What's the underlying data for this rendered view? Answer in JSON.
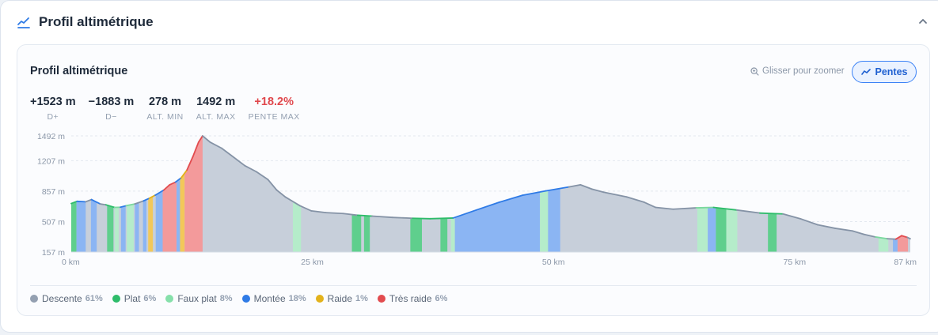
{
  "header": {
    "title": "Profil altimétrique",
    "icon": "chart-line-icon",
    "collapse_icon": "chevron-up-icon"
  },
  "card": {
    "title": "Profil altimétrique",
    "zoom_hint": "Glisser pour zoomer",
    "slopes_button": "Pentes"
  },
  "stats": [
    {
      "value": "+1523 m",
      "label": "D+"
    },
    {
      "value": "−1883 m",
      "label": "D−"
    },
    {
      "value": "278 m",
      "label": "ALT. MIN"
    },
    {
      "value": "1492 m",
      "label": "ALT. MAX"
    },
    {
      "value": "+18.2%",
      "label": "PENTE MAX"
    }
  ],
  "colors": {
    "descente": "#94a0b1",
    "plat": "#2ebc6a",
    "faux_plat": "#86e0aa",
    "montee": "#2f7be6",
    "raide": "#e3b21b",
    "tres_raide": "#e24b4e"
  },
  "legend": [
    {
      "label": "Descente",
      "pct": "61%",
      "color": "#94a0b1"
    },
    {
      "label": "Plat",
      "pct": "6%",
      "color": "#2ebc6a"
    },
    {
      "label": "Faux plat",
      "pct": "8%",
      "color": "#86e0aa"
    },
    {
      "label": "Montée",
      "pct": "18%",
      "color": "#2f7be6"
    },
    {
      "label": "Raide",
      "pct": "1%",
      "color": "#e3b21b"
    },
    {
      "label": "Très raide",
      "pct": "6%",
      "color": "#e24b4e"
    }
  ],
  "chart_data": {
    "type": "area",
    "xlabel": "",
    "ylabel": "",
    "x_unit": "km",
    "y_unit": "m",
    "xlim": [
      0,
      87
    ],
    "ylim": [
      157,
      1492
    ],
    "x_ticks": [
      "0 km",
      "25 km",
      "50 km",
      "75 km",
      "87 km"
    ],
    "x_tick_values": [
      0,
      25,
      50,
      75,
      87
    ],
    "y_ticks": [
      "1492 m",
      "1207 m",
      "857 m",
      "507 m",
      "157 m"
    ],
    "y_tick_values": [
      1492,
      1207,
      857,
      507,
      157
    ],
    "grid": true,
    "series": [
      {
        "name": "",
        "points": [
          [
            0,
            715
          ],
          [
            1,
            740
          ],
          [
            2.5,
            735
          ],
          [
            3.5,
            760
          ],
          [
            5,
            710
          ],
          [
            6,
            700
          ],
          [
            6.5,
            690
          ],
          [
            7.5,
            670
          ],
          [
            8.5,
            672
          ],
          [
            9.5,
            690
          ],
          [
            11,
            710
          ],
          [
            12.5,
            745
          ],
          [
            13.5,
            775
          ],
          [
            14.5,
            810
          ],
          [
            16,
            870
          ],
          [
            17,
            930
          ],
          [
            18,
            960
          ],
          [
            19,
            1010
          ],
          [
            20,
            1100
          ],
          [
            21,
            1250
          ],
          [
            22,
            1420
          ],
          [
            22.7,
            1492
          ],
          [
            24,
            1420
          ],
          [
            26,
            1350
          ],
          [
            28,
            1250
          ],
          [
            30,
            1150
          ],
          [
            32,
            1080
          ],
          [
            34,
            990
          ],
          [
            35.5,
            870
          ],
          [
            37,
            790
          ],
          [
            39.5,
            690
          ],
          [
            41.5,
            630
          ],
          [
            44,
            610
          ],
          [
            47,
            600
          ],
          [
            49.5,
            580
          ],
          [
            52,
            570
          ],
          [
            55.5,
            555
          ],
          [
            59,
            545
          ],
          [
            62,
            540
          ],
          [
            66,
            548
          ],
          [
            70,
            640
          ],
          [
            74,
            730
          ],
          [
            78,
            810
          ],
          [
            82,
            860
          ],
          [
            86,
            905
          ],
          [
            88,
            930
          ],
          [
            90,
            880
          ],
          [
            92,
            845
          ],
          [
            96,
            790
          ],
          [
            99,
            730
          ],
          [
            101,
            670
          ],
          [
            104,
            650
          ],
          [
            108,
            665
          ],
          [
            111,
            670
          ],
          [
            115,
            640
          ],
          [
            119,
            605
          ],
          [
            123,
            595
          ],
          [
            126,
            540
          ],
          [
            129,
            470
          ],
          [
            132,
            430
          ],
          [
            135,
            400
          ],
          [
            137,
            360
          ],
          [
            139,
            330
          ],
          [
            141,
            310
          ],
          [
            142.5,
            305
          ],
          [
            143.5,
            345
          ],
          [
            144.5,
            325
          ],
          [
            145,
            310
          ]
        ]
      }
    ],
    "segments": [
      {
        "from": 0,
        "to": 0.9,
        "class": "plat"
      },
      {
        "from": 0.9,
        "to": 2.5,
        "class": "montee"
      },
      {
        "from": 3.4,
        "to": 4.4,
        "class": "montee"
      },
      {
        "from": 6.2,
        "to": 7.3,
        "class": "plat"
      },
      {
        "from": 7.5,
        "to": 8.2,
        "class": "faux_plat"
      },
      {
        "from": 8.6,
        "to": 9.4,
        "class": "montee"
      },
      {
        "from": 9.6,
        "to": 10.8,
        "class": "faux_plat"
      },
      {
        "from": 11,
        "to": 11.7,
        "class": "montee"
      },
      {
        "from": 12.4,
        "to": 13.0,
        "class": "montee"
      },
      {
        "from": 13.3,
        "to": 14.1,
        "class": "raide"
      },
      {
        "from": 14.6,
        "to": 15.8,
        "class": "montee"
      },
      {
        "from": 15.8,
        "to": 18.2,
        "class": "tres_raide"
      },
      {
        "from": 18.2,
        "to": 18.8,
        "class": "montee"
      },
      {
        "from": 18.8,
        "to": 19.6,
        "class": "raide"
      },
      {
        "from": 19.6,
        "to": 22.7,
        "class": "tres_raide"
      },
      {
        "from": 38.3,
        "to": 39.7,
        "class": "faux_plat"
      },
      {
        "from": 48.5,
        "to": 50.1,
        "class": "plat"
      },
      {
        "from": 50.6,
        "to": 51.6,
        "class": "plat"
      },
      {
        "from": 58.6,
        "to": 60.6,
        "class": "plat"
      },
      {
        "from": 63.8,
        "to": 65.0,
        "class": "plat"
      },
      {
        "from": 65.6,
        "to": 66.3,
        "class": "faux_plat"
      },
      {
        "from": 66.3,
        "to": 81.0,
        "class": "montee"
      },
      {
        "from": 81.0,
        "to": 82.4,
        "class": "faux_plat"
      },
      {
        "from": 82.4,
        "to": 84.5,
        "class": "montee"
      },
      {
        "from": 108.2,
        "to": 110.0,
        "class": "faux_plat"
      },
      {
        "from": 110.0,
        "to": 111.4,
        "class": "montee"
      },
      {
        "from": 111.4,
        "to": 113.2,
        "class": "plat"
      },
      {
        "from": 113.2,
        "to": 115.1,
        "class": "faux_plat"
      },
      {
        "from": 120.4,
        "to": 121.9,
        "class": "plat"
      },
      {
        "from": 139.5,
        "to": 141.2,
        "class": "faux_plat"
      },
      {
        "from": 142.0,
        "to": 142.8,
        "class": "montee"
      },
      {
        "from": 142.8,
        "to": 144.6,
        "class": "tres_raide"
      }
    ],
    "path_scale_note": ""
  }
}
